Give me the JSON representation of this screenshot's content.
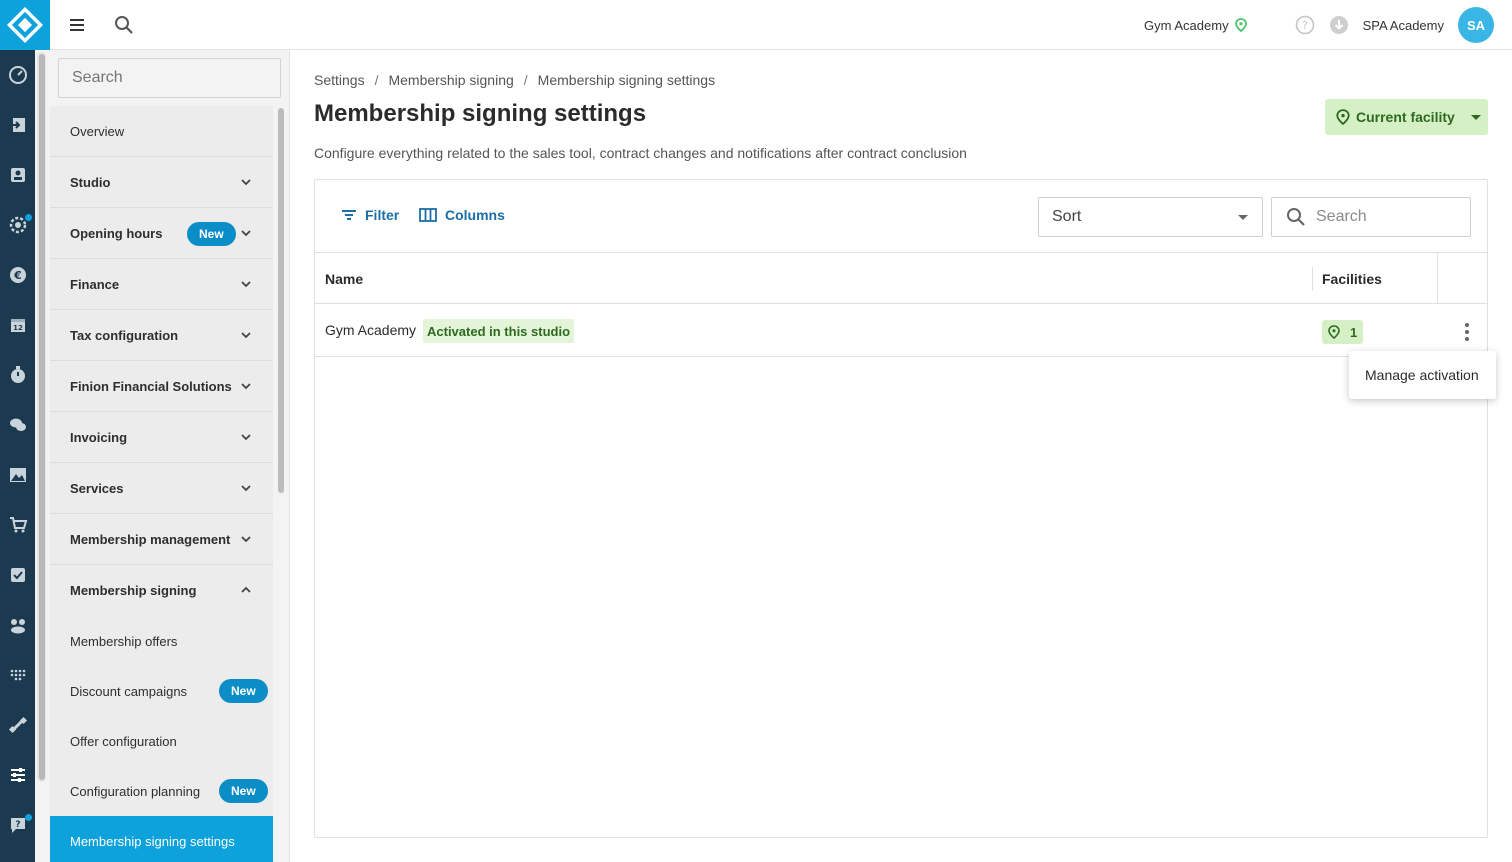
{
  "topbar": {
    "facility_name": "Gym Academy",
    "studio_name": "SPA Academy",
    "avatar_initials": "SA"
  },
  "colors": {
    "rail": "#1c3a4f",
    "accent": "#0da2dc",
    "success_bg": "#d6f0c5",
    "success_text": "#2d6a1f",
    "link": "#1b6ea8"
  },
  "sidenav": {
    "search_placeholder": "Search",
    "items": [
      {
        "label": "Overview"
      },
      {
        "label": "Studio"
      },
      {
        "label": "Opening hours",
        "badge": "New"
      },
      {
        "label": "Finance"
      },
      {
        "label": "Tax configuration"
      },
      {
        "label": "Finion Financial Solutions"
      },
      {
        "label": "Invoicing"
      },
      {
        "label": "Services"
      },
      {
        "label": "Membership management"
      },
      {
        "label": "Membership signing"
      }
    ],
    "subitems": [
      {
        "label": "Membership offers"
      },
      {
        "label": "Discount campaigns",
        "badge": "New"
      },
      {
        "label": "Offer configuration"
      },
      {
        "label": "Configuration planning",
        "badge": "New"
      },
      {
        "label": "Membership signing settings"
      }
    ]
  },
  "main": {
    "breadcrumb": [
      "Settings",
      "Membership signing",
      "Membership signing settings"
    ],
    "breadcrumb_sep": "/",
    "title": "Membership signing settings",
    "description": "Configure everything related to the sales tool, contract changes and notifications after contract conclusion",
    "facility_button": "Current facility",
    "toolbar": {
      "filter_label": "Filter",
      "columns_label": "Columns",
      "sort_label": "Sort",
      "search_placeholder": "Search"
    },
    "table": {
      "columns": [
        "Name",
        "Facilities"
      ],
      "rows": [
        {
          "name": "Gym Academy",
          "status": "Activated in this studio",
          "facilities": "1"
        }
      ]
    },
    "context_menu": [
      "Manage activation"
    ]
  }
}
